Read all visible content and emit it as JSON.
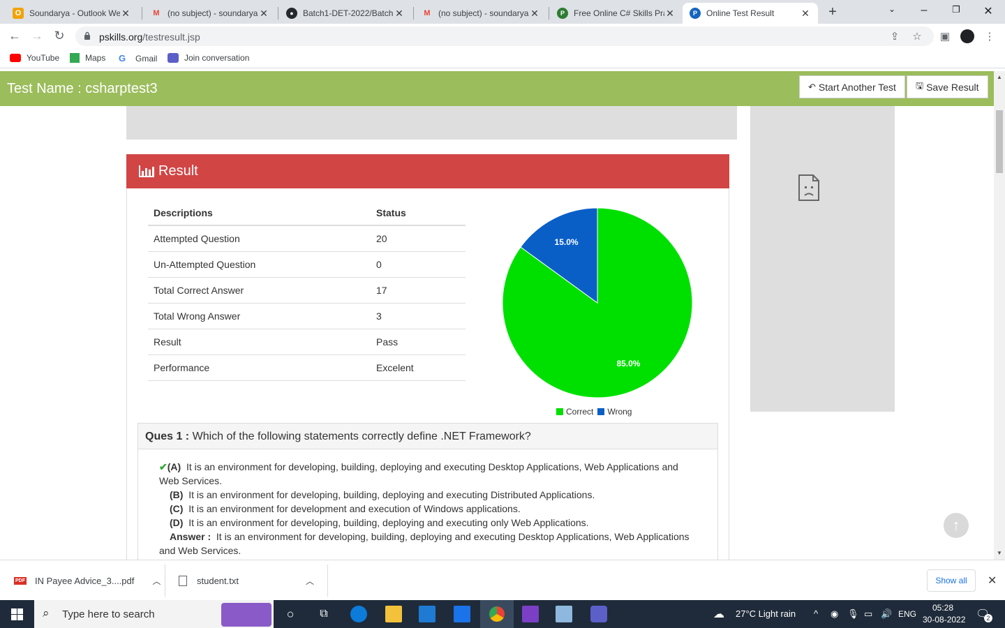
{
  "browser": {
    "tabs": [
      {
        "title": "Soundarya - Outlook We",
        "icon": "outlook-icon",
        "color": "#f0a30a",
        "glyph": "O"
      },
      {
        "title": "(no subject) - soundarya",
        "icon": "gmail-icon",
        "color": "#ea4335",
        "glyph": "M"
      },
      {
        "title": "Batch1-DET-2022/Batch",
        "icon": "github-icon",
        "color": "#24292e",
        "glyph": "●"
      },
      {
        "title": "(no subject) - soundarya",
        "icon": "gmail-icon",
        "color": "#ea4335",
        "glyph": "M"
      },
      {
        "title": "Free Online C# Skills Pra",
        "icon": "pskills-icon",
        "color": "#2e7d32",
        "glyph": "P"
      },
      {
        "title": "Online Test Result",
        "icon": "pskills-icon",
        "color": "#1565c0",
        "glyph": "P"
      }
    ],
    "url_host": "pskills.org",
    "url_path": "/testresult.jsp",
    "bookmarks": [
      "YouTube",
      "Maps",
      "Gmail",
      "Join conversation"
    ]
  },
  "page": {
    "test_name": "Test Name : csharptest3",
    "start_another": "Start Another Test",
    "save_result": "Save Result",
    "result_title": "Result",
    "table": {
      "headers": [
        "Descriptions",
        "Status"
      ],
      "rows": [
        [
          "Attempted Question",
          "20"
        ],
        [
          "Un-Attempted Question",
          "0"
        ],
        [
          "Total Correct Answer",
          "17"
        ],
        [
          "Total Wrong Answer",
          "3"
        ],
        [
          "Result",
          "Pass"
        ],
        [
          "Performance",
          "Excelent"
        ]
      ]
    },
    "question": {
      "label": "Ques 1 :",
      "text": "Which of the following statements correctly define .NET Framework?",
      "options": [
        {
          "key": "(A)",
          "text": "It is an environment for developing, building, deploying and executing Desktop Applications, Web Applications and Web Services.",
          "correct": true
        },
        {
          "key": "(B)",
          "text": "It is an environment for developing, building, deploying and executing Distributed Applications.",
          "correct": false
        },
        {
          "key": "(C)",
          "text": "It is an environment for development and execution of Windows applications.",
          "correct": false
        },
        {
          "key": "(D)",
          "text": "It is an environment for developing, building, deploying and executing only Web Applications.",
          "correct": false
        }
      ],
      "answer_label": "Answer :",
      "answer_text": "It is an environment for developing, building, deploying and executing Desktop Applications, Web Applications and Web Services."
    }
  },
  "chart_data": {
    "type": "pie",
    "categories": [
      "Correct",
      "Wrong"
    ],
    "values": [
      85.0,
      15.0
    ],
    "labels": [
      "85.0%",
      "15.0%"
    ],
    "colors": [
      "#00e000",
      "#0a5fc7"
    ],
    "legend": "bottom"
  },
  "downloads": {
    "items": [
      "IN Payee Advice_3....pdf",
      "student.txt"
    ],
    "show_all": "Show all"
  },
  "taskbar": {
    "search_placeholder": "Type here to search",
    "weather": "27°C  Light rain",
    "lang": "ENG",
    "time": "05:28",
    "date": "30-08-2022",
    "notifications": "2"
  },
  "colors": {
    "header_green": "#9bbd5b",
    "result_red": "#d24545"
  }
}
